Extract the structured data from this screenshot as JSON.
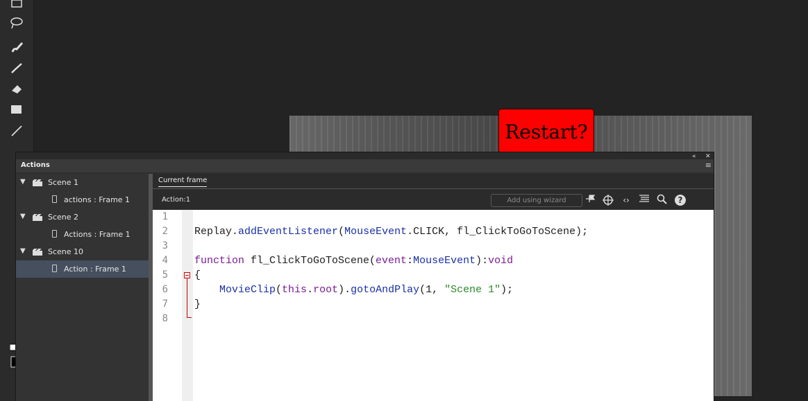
{
  "toolbar": {
    "tools": [
      {
        "name": "free-transform-icon"
      },
      {
        "name": "lasso-icon"
      },
      {
        "name": "paint-brush-icon"
      },
      {
        "name": "brush-icon"
      },
      {
        "name": "eraser-icon"
      },
      {
        "name": "rectangle-icon"
      },
      {
        "name": "line-icon"
      }
    ]
  },
  "stage": {
    "restart_button_label": "Restart?",
    "restart_button_color": "#ff0000"
  },
  "actions_panel": {
    "title": "Actions",
    "tree": [
      {
        "type": "scene",
        "label": "Scene 1"
      },
      {
        "type": "frame",
        "label": "actions : Frame 1"
      },
      {
        "type": "scene",
        "label": "Scene 2"
      },
      {
        "type": "frame",
        "label": "Actions : Frame 1"
      },
      {
        "type": "scene",
        "label": "Scene 10"
      },
      {
        "type": "frame",
        "label": "Action : Frame 1",
        "selected": true
      }
    ],
    "tab_label": "Current frame",
    "script_name": "Action:1",
    "wizard_label": "Add using wizard",
    "line_numbers": [
      "1",
      "2",
      "3",
      "4",
      "5",
      "6",
      "7",
      "8"
    ],
    "code": {
      "line2": {
        "obj": "Replay",
        "dot": ".",
        "method": "addEventListener",
        "open": "(",
        "cls": "MouseEvent",
        "rest": ".CLICK, fl_ClickToGoToScene);"
      },
      "line4": {
        "kw": "function",
        "name": " fl_ClickToGoToScene(",
        "param": "event",
        "colon": ":",
        "type": "MouseEvent",
        "close": "):",
        "ret": "void"
      },
      "line5": "{",
      "line6": {
        "indent": "    ",
        "cls": "MovieClip",
        "open": "(",
        "kw": "this",
        "dot": ".",
        "prop": "root",
        "close": ").",
        "method": "gotoAndPlay",
        "args": "(1, ",
        "str": "\"Scene 1\"",
        "end": ");"
      },
      "line7": "}"
    },
    "colors": {
      "function_blue": "#1a2fa8",
      "keyword_purple": "#7a1b94",
      "string_green": "#2c8a2c",
      "fold_red": "#cc0000"
    }
  }
}
